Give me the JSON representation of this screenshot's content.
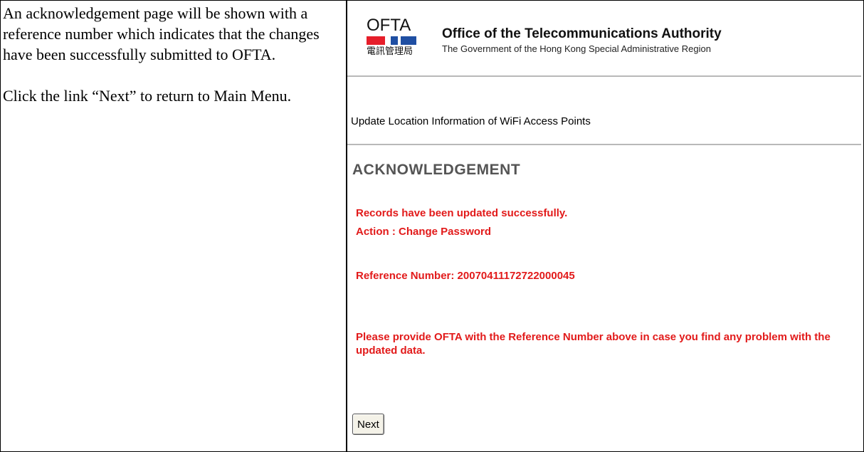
{
  "instructions": {
    "paragraph1": "An acknowledgement page will be shown with a reference number which indicates that the changes have been successfully submitted to OFTA.",
    "paragraph2": "Click the link “Next” to return to Main Menu."
  },
  "header": {
    "logo_text": "OFTA",
    "logo_chinese": "電訊管理局",
    "title": "Office of the Telecommunications Authority",
    "subtitle": "The Government of the Hong Kong Special Administrative Region"
  },
  "breadcrumb": "Update Location Information of WiFi Access Points",
  "page_heading": "ACKNOWLEDGEMENT",
  "messages": {
    "success": "Records have been updated successfully.",
    "action": "Action : Change Password",
    "reference": "Reference Number: 20070411172722000045",
    "note": "Please provide OFTA with the Reference Number above in case you find any problem with the updated data."
  },
  "next_button_label": "Next",
  "colors": {
    "message_red": "#e21a1a",
    "logo_red": "#e61e2a",
    "logo_blue": "#1f4fa3",
    "separator_gray": "#b9b9b9"
  }
}
